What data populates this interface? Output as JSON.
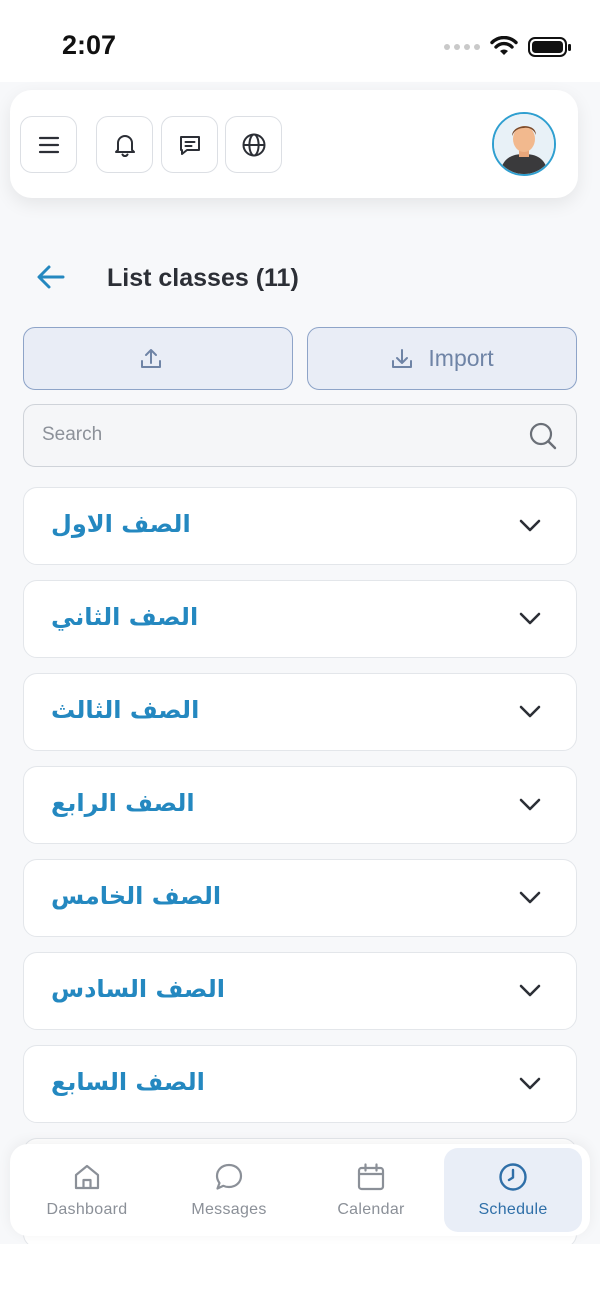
{
  "status_bar": {
    "time": "2:07"
  },
  "header": {
    "menu_icon": "hamburger-icon",
    "notification_icon": "bell-icon",
    "messages_icon": "chat-icon",
    "language_icon": "globe-icon",
    "avatar_icon": "user-avatar"
  },
  "page": {
    "title": "List classes (11)",
    "back_icon": "arrow-left-icon"
  },
  "actions": {
    "export_label": "",
    "import_label": "Import"
  },
  "search": {
    "placeholder": "Search",
    "value": ""
  },
  "classes": [
    {
      "label": "الصف الاول"
    },
    {
      "label": "الصف الثاني"
    },
    {
      "label": "الصف الثالث"
    },
    {
      "label": "الصف الرابع"
    },
    {
      "label": "الصف الخامس"
    },
    {
      "label": "الصف السادس"
    },
    {
      "label": "الصف السابع"
    }
  ],
  "bottom_nav": [
    {
      "label": "Dashboard",
      "icon": "home-icon",
      "active": false
    },
    {
      "label": "Messages",
      "icon": "chat-bubble-icon",
      "active": false
    },
    {
      "label": "Calendar",
      "icon": "calendar-icon",
      "active": false
    },
    {
      "label": "Schedule",
      "icon": "clock-icon",
      "active": true
    }
  ],
  "colors": {
    "accent": "#2488c0",
    "nav_active": "#2f6fa8",
    "action_bg": "#e9edf6"
  }
}
